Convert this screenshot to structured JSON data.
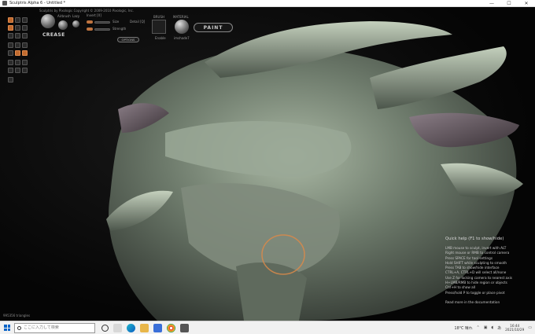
{
  "window": {
    "title": "Sculptris Alpha 6 - Untitled *",
    "controls": [
      "—",
      "☐",
      "✕"
    ]
  },
  "toolbar": {
    "brand": "Sculptris by Pixologic   Copyright © 2009-2010 Pixologic, Inc.",
    "brush_name": "CREASE",
    "airbrush_label": "Airbrush",
    "lazy_label": "Lazy",
    "invert_label": "Invert [X]",
    "size_label": "Size",
    "strength_label": "Strength",
    "detail_label": "Detail [Q]",
    "options_label": "OPTIONS",
    "brush_section": "BRUSH",
    "material_section": "MATERIAL",
    "enable_label": "Enable",
    "imshade_label": "imshade7",
    "paint_label": "PAINT"
  },
  "quick_help": {
    "title": "Quick help (F1 to show/hide)",
    "lines": [
      "LMB mouse to sculpt, invert with ALT",
      "Right mouse or RMB to control camera",
      "Press SPACE for tool settings",
      "Hold SHIFT while sculpting to smooth",
      "Press TAB to show/hide interface",
      "CTRL+A, CTRL+D will select all/none",
      "Use Z for locking camera to nearest axis",
      "H+LMB/RMB to hide region or objects",
      "Ctrl+H to show all",
      "Press/hold P to toggle or place pivot"
    ],
    "footer": "Read more in the documentation"
  },
  "status": {
    "triangles": "995356 triangles"
  },
  "taskbar": {
    "search_placeholder": "ここに入力して検索",
    "weather": "18°C  晴れ",
    "time": "16:44",
    "date": "2021/10/29"
  },
  "colors": {
    "accent": "#c06a2e",
    "model": "#7e8a7c",
    "background": "#050505"
  }
}
